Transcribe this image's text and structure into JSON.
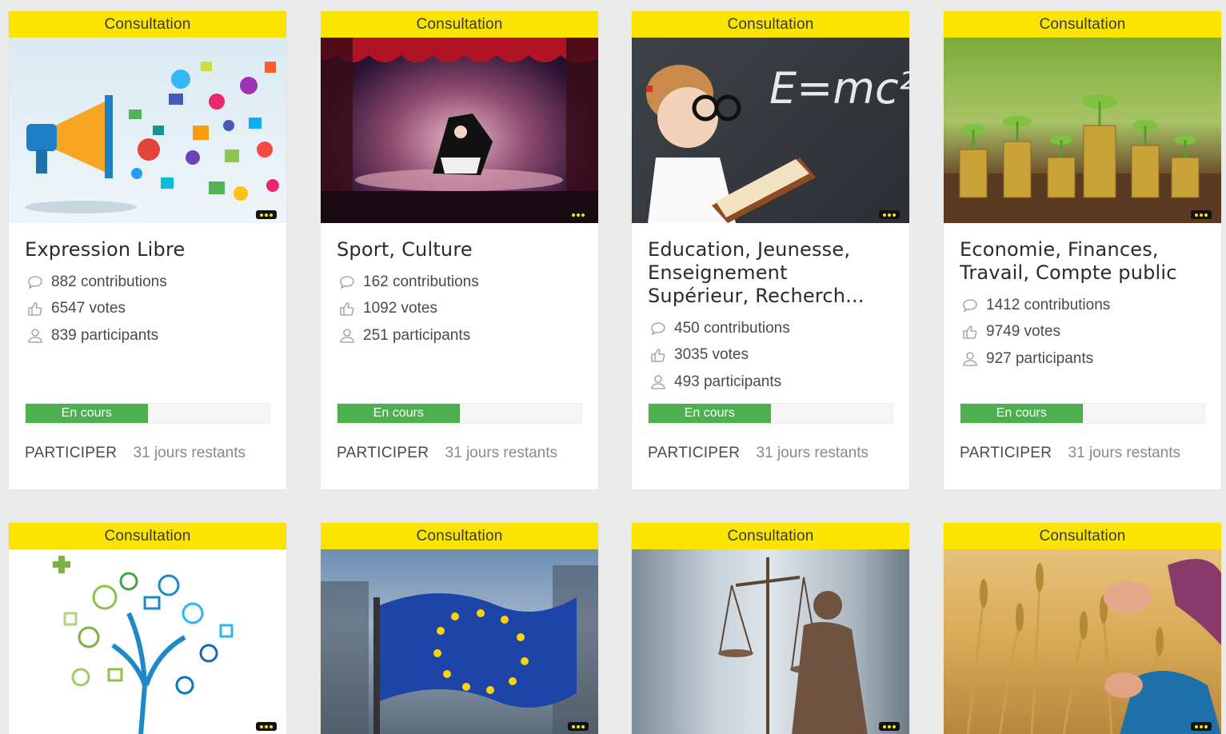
{
  "cards": [
    {
      "badge": "Consultation",
      "title": "Expression Libre",
      "contributions": "882 contributions",
      "votes": "6547 votes",
      "participants": "839 participants",
      "status": "En cours",
      "progress": 0.5,
      "cta": "PARTICIPER",
      "remaining": "31 jours restants",
      "image": "megaphone-with-social-icons"
    },
    {
      "badge": "Consultation",
      "title": "Sport, Culture",
      "contributions": "162 contributions",
      "votes": "1092 votes",
      "participants": "251 participants",
      "status": "En cours",
      "progress": 0.5,
      "cta": "PARTICIPER",
      "remaining": "31 jours restants",
      "image": "theatre-stage-performer"
    },
    {
      "badge": "Consultation",
      "title": "Education, Jeunesse, Enseignement Supérieur, Recherch...",
      "contributions": "450 contributions",
      "votes": "3035 votes",
      "participants": "493 participants",
      "status": "En cours",
      "progress": 0.5,
      "cta": "PARTICIPER",
      "remaining": "31 jours restants",
      "image": "girl-with-book-emc2-blackboard",
      "image_text": "E=mc²"
    },
    {
      "badge": "Consultation",
      "title": "Economie, Finances, Travail, Compte public",
      "contributions": "1412 contributions",
      "votes": "9749 votes",
      "participants": "927 participants",
      "status": "En cours",
      "progress": 0.5,
      "cta": "PARTICIPER",
      "remaining": "31 jours restants",
      "image": "plants-on-coin-stacks"
    },
    {
      "badge": "Consultation",
      "image": "health-icon-tree"
    },
    {
      "badge": "Consultation",
      "image": "eu-flag-building"
    },
    {
      "badge": "Consultation",
      "image": "lady-justice-statue"
    },
    {
      "badge": "Consultation",
      "image": "hands-wheat-field"
    }
  ],
  "colors": {
    "ribbon": "#fbe400",
    "progress_fill": "#4caf50",
    "background": "#ebebeb"
  },
  "icons": [
    "comment-icon",
    "thumbs-up-icon",
    "user-icon",
    "more-dots-icon"
  ]
}
